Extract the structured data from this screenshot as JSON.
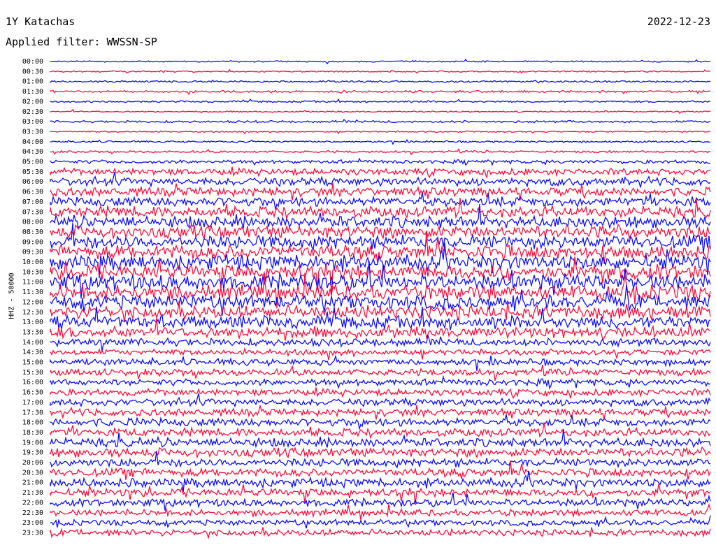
{
  "header": {
    "station": "1Y Katachas",
    "date": "2022-12-23",
    "filter_line": "Applied filter: WWSSN-SP"
  },
  "chart_data": {
    "type": "line",
    "title": "1Y Katachas",
    "ylabel": "HHZ - 50000",
    "row_labels": [
      "00:00",
      "00:30",
      "01:00",
      "01:30",
      "02:00",
      "02:30",
      "03:00",
      "03:30",
      "04:00",
      "04:30",
      "05:00",
      "05:30",
      "06:00",
      "06:30",
      "07:00",
      "07:30",
      "08:00",
      "08:30",
      "09:00",
      "09:30",
      "10:00",
      "10:30",
      "11:00",
      "11:30",
      "12:00",
      "12:30",
      "13:00",
      "13:30",
      "14:00",
      "14:30",
      "15:00",
      "15:30",
      "16:00",
      "16:30",
      "17:00",
      "17:30",
      "18:00",
      "18:30",
      "19:00",
      "19:30",
      "20:00",
      "20:30",
      "21:00",
      "21:30",
      "22:00",
      "22:30",
      "23:00",
      "23:30"
    ],
    "series_colors": [
      "#0000ff",
      "#ff0033"
    ],
    "relative_amplitude": [
      0.2,
      0.2,
      0.25,
      0.3,
      0.25,
      0.2,
      0.3,
      0.2,
      0.25,
      0.3,
      0.5,
      0.9,
      1.1,
      1.2,
      1.3,
      1.5,
      1.6,
      1.7,
      1.8,
      1.9,
      2.0,
      2.0,
      2.1,
      2.0,
      1.9,
      1.8,
      1.7,
      1.5,
      1.0,
      0.8,
      0.9,
      0.9,
      0.9,
      0.9,
      1.0,
      1.0,
      1.1,
      1.1,
      1.2,
      1.2,
      1.1,
      1.1,
      1.2,
      1.1,
      1.0,
      0.9,
      0.8,
      0.9
    ]
  }
}
